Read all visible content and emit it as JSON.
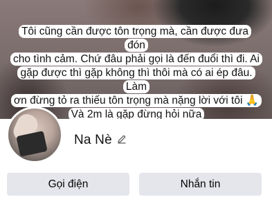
{
  "cover": {
    "caption_lines": [
      "Tôi cũng cần được tôn trọng mà, cần được đưa đón",
      "cho tình cảm. Chứ đâu phải gọi là đến đuổi thì đi. Ai",
      "gặp được thì gặp không thì thôi mà có ai ép đâu. Làm",
      "ơn đừng tỏ ra thiếu tôn trọng mà nặng lời với tôi 🙏",
      "Và 2m là gặp đừng hỏi nữa"
    ]
  },
  "profile": {
    "name": "Na Nè"
  },
  "icons": {
    "edit": "pencil-edit-icon"
  },
  "actions": {
    "call_label": "Gọi điện",
    "message_label": "Nhắn tin"
  },
  "colors": {
    "button_bg": "#e4e6eb",
    "text": "#050505"
  }
}
